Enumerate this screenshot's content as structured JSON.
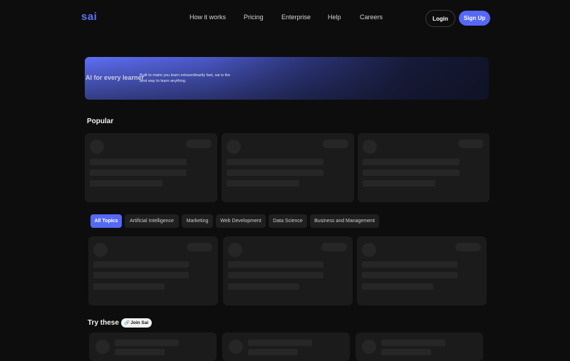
{
  "nav": {
    "logo": "sai",
    "links": [
      "How it works",
      "Pricing",
      "Enterprise",
      "Help",
      "Careers"
    ],
    "login": "Login",
    "signup": "Sign Up"
  },
  "hero": {
    "title": "AI for every learner",
    "description": "Built to make you learn extraordinarily fast, sai is the best way to learn anything."
  },
  "popular": {
    "title": "Popular"
  },
  "topics": {
    "tabs": [
      "All Topics",
      "Artificial Intelligence",
      "Marketing",
      "Web Development",
      "Data Science",
      "Business and Management"
    ],
    "active": "All Topics"
  },
  "try_these": {
    "title": "Try these",
    "badge": "Join Sai",
    "badge_icon": "link-icon"
  },
  "colors": {
    "accent": "#5668f6",
    "background": "#0d0d0d",
    "card": "#1b1b1b",
    "skeleton": "#262626"
  }
}
